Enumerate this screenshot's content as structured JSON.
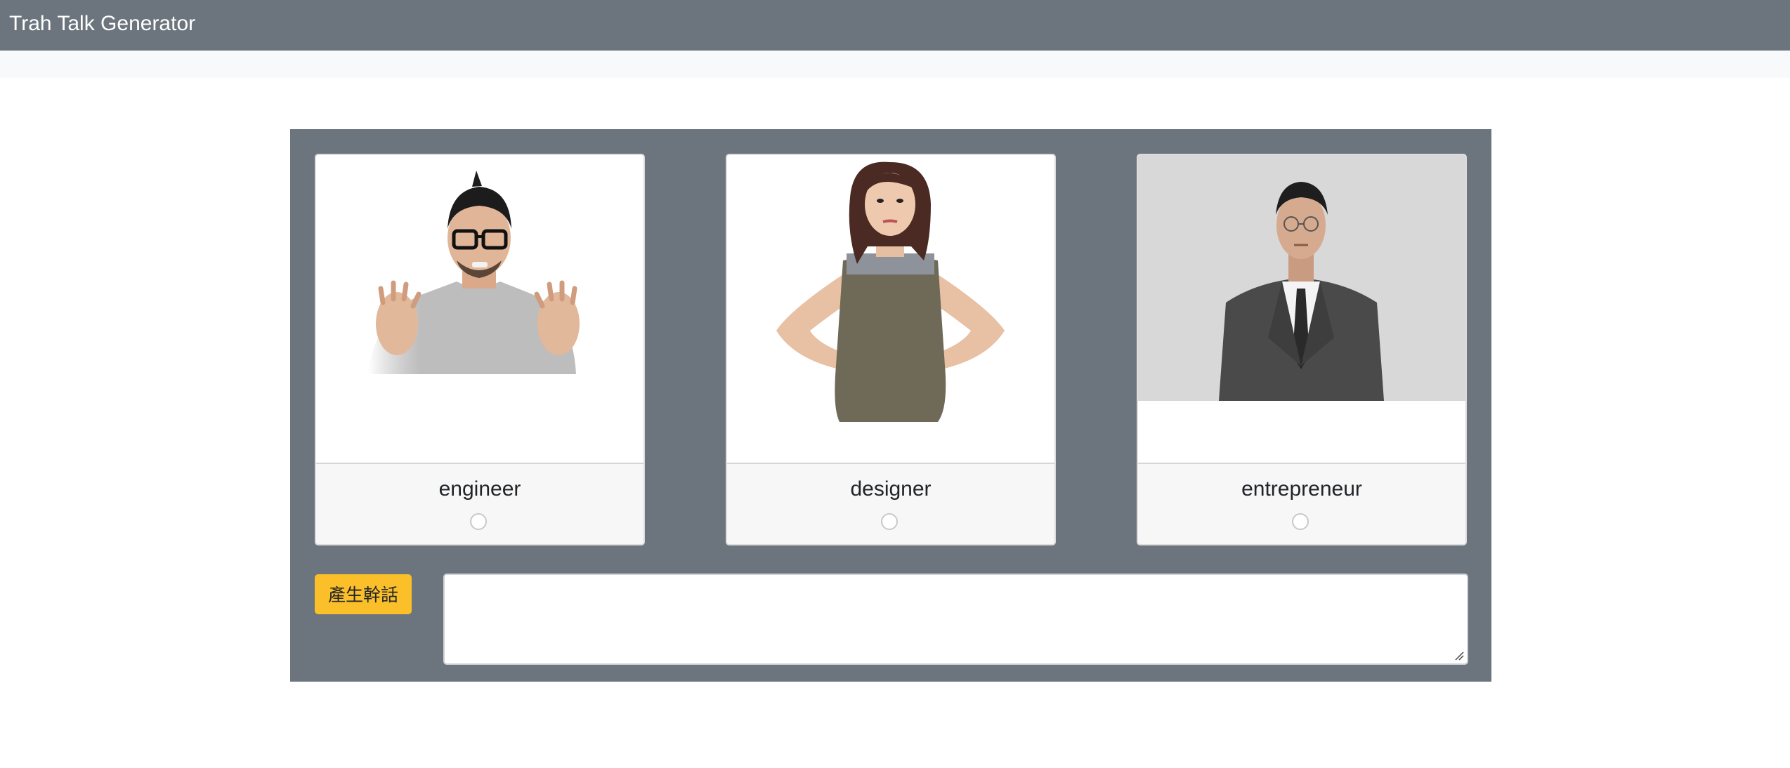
{
  "navbar": {
    "title": "Trah Talk Generator"
  },
  "cards": [
    {
      "label": "engineer",
      "icon": "frustrated-man-with-glasses-photo"
    },
    {
      "label": "designer",
      "icon": "woman-in-apron-photo"
    },
    {
      "label": "entrepreneur",
      "icon": "man-in-suit-photo"
    }
  ],
  "controls": {
    "generate_label": "產生幹話",
    "output_value": "",
    "button_color": "#fbbf2a"
  },
  "colors": {
    "navbar": "#6c757d",
    "panel": "#6c757d",
    "subbar": "#f8f9fa"
  }
}
